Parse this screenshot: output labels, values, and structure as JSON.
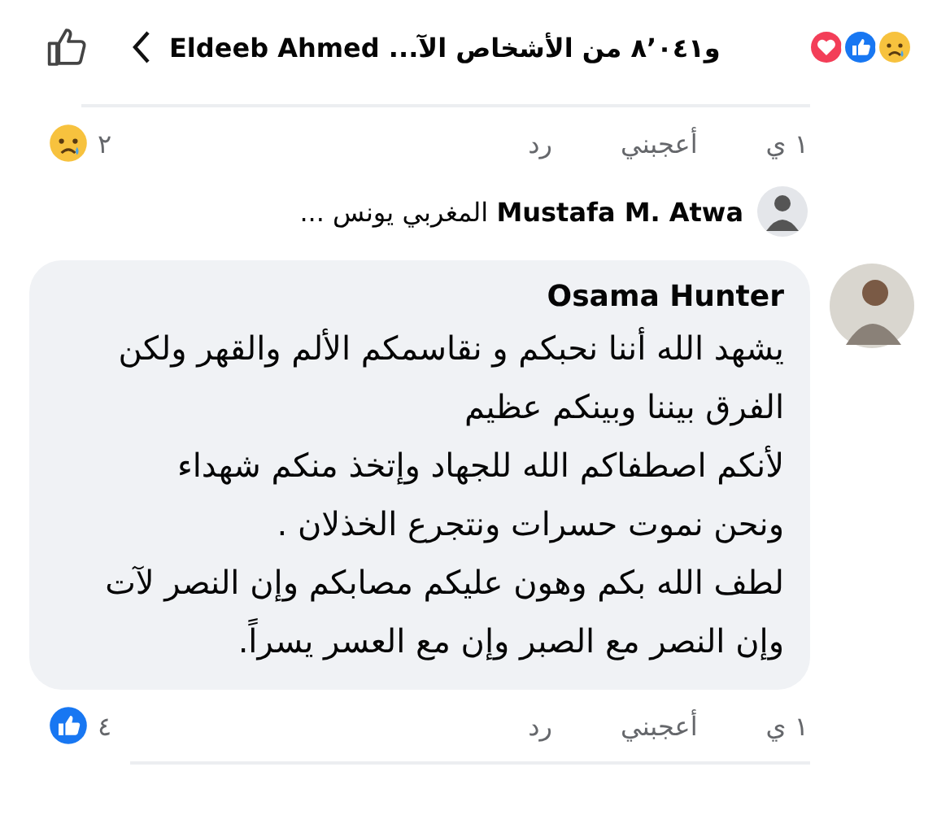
{
  "header": {
    "title": "و٨٬٠٤١ من الأشخاص الآ... Eldeeb Ahmed"
  },
  "previous_comment_footer": {
    "time": "١ ي",
    "like": "أعجبني",
    "reply": "رد",
    "reaction_count": "٢"
  },
  "reply_preview": {
    "name": "Mustafa M. Atwa",
    "snippet": "المغربي يونس ..."
  },
  "comment": {
    "author": "Osama Hunter",
    "lines": [
      "يشهد الله أننا نحبكم و نقاسمكم الألم والقهر ولكن",
      "الفرق بيننا وبينكم عظيم",
      "لأنكم اصطفاكم الله للجهاد وإتخذ منكم شهداء",
      "ونحن نموت حسرات ونتجرع الخذلان .",
      "لطف الله بكم وهون عليكم مصابكم وإن النصر لآت",
      "وإن النصر مع الصبر وإن مع العسر يسراً."
    ],
    "time": "١ ي",
    "like": "أعجبني",
    "reply": "رد",
    "reaction_count": "٤"
  }
}
